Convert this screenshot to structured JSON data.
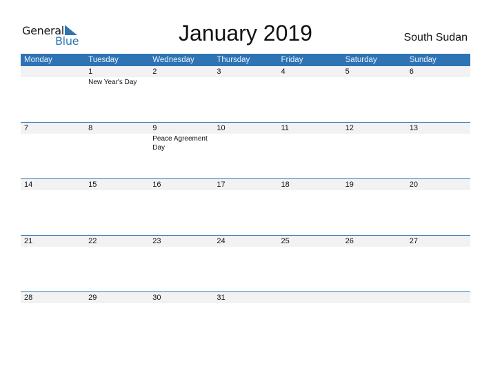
{
  "logo": {
    "word1": "General",
    "word2": "Blue"
  },
  "title": "January 2019",
  "country": "South Sudan",
  "colors": {
    "accent": "#2e74b5",
    "band": "#f2f2f2"
  },
  "weekdays": [
    "Monday",
    "Tuesday",
    "Wednesday",
    "Thursday",
    "Friday",
    "Saturday",
    "Sunday"
  ],
  "weeks": [
    [
      {
        "day": ""
      },
      {
        "day": "1",
        "holiday": "New Year's Day"
      },
      {
        "day": "2"
      },
      {
        "day": "3"
      },
      {
        "day": "4"
      },
      {
        "day": "5"
      },
      {
        "day": "6"
      }
    ],
    [
      {
        "day": "7"
      },
      {
        "day": "8"
      },
      {
        "day": "9",
        "holiday": "Peace Agreement Day"
      },
      {
        "day": "10"
      },
      {
        "day": "11"
      },
      {
        "day": "12"
      },
      {
        "day": "13"
      }
    ],
    [
      {
        "day": "14"
      },
      {
        "day": "15"
      },
      {
        "day": "16"
      },
      {
        "day": "17"
      },
      {
        "day": "18"
      },
      {
        "day": "19"
      },
      {
        "day": "20"
      }
    ],
    [
      {
        "day": "21"
      },
      {
        "day": "22"
      },
      {
        "day": "23"
      },
      {
        "day": "24"
      },
      {
        "day": "25"
      },
      {
        "day": "26"
      },
      {
        "day": "27"
      }
    ],
    [
      {
        "day": "28"
      },
      {
        "day": "29"
      },
      {
        "day": "30"
      },
      {
        "day": "31"
      },
      {
        "day": ""
      },
      {
        "day": ""
      },
      {
        "day": ""
      }
    ]
  ]
}
